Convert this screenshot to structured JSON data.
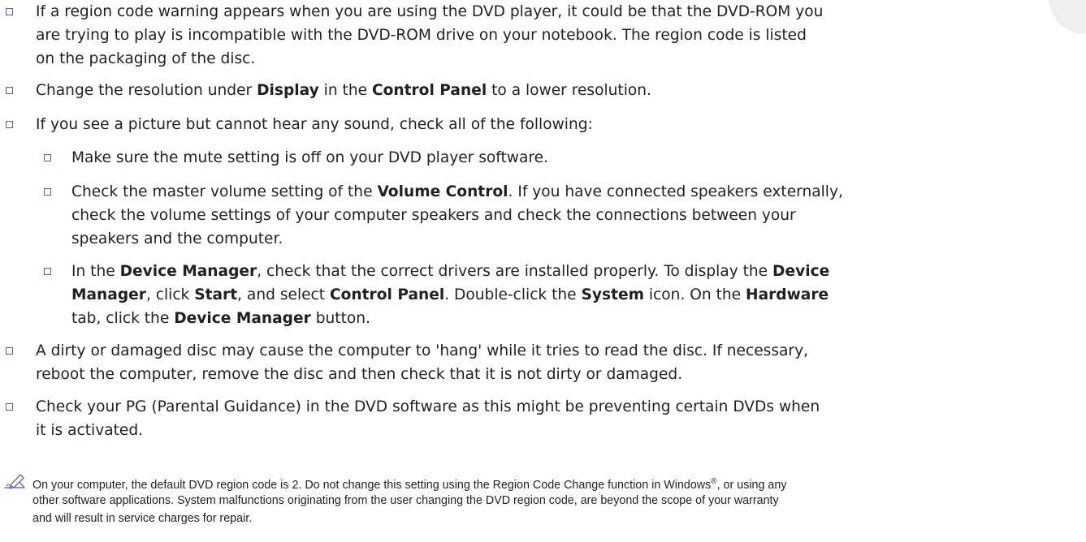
{
  "items": [
    {
      "lines": [
        "If a region code warning appears when you are using the DVD player, it could be that the DVD-ROM you",
        "are trying to play is incompatible with the DVD-ROM drive on your notebook. The region code is listed",
        "on the packaging of the disc."
      ]
    },
    {
      "parts": [
        "Change the resolution under ",
        "Display",
        " in the ",
        "Control Panel",
        " to a lower resolution."
      ]
    },
    {
      "text": "If you see a picture but cannot hear any sound, check all of the following:"
    },
    {
      "text": "Make sure the mute setting is off on your DVD player software."
    },
    {
      "line1_parts": [
        "Check the master volume setting of the ",
        "Volume Control",
        ". If you have connected speakers externally,"
      ],
      "line2": "check the volume settings of your computer speakers and check the connections between your",
      "line3": "speakers and the computer."
    },
    {
      "line1_parts": [
        "In the ",
        "Device Manager",
        ", check that the correct drivers are installed properly. To display the ",
        "Device"
      ],
      "line2_parts": [
        "Manager",
        ", click ",
        "Start",
        ", and select ",
        "Control Panel",
        ". Double-click the ",
        "System",
        " icon. On the ",
        "Hardware"
      ],
      "line3_parts": [
        "tab, click the ",
        "Device Manager",
        " button."
      ]
    },
    {
      "lines": [
        "A dirty or damaged disc may cause the computer to 'hang' while it tries to read the disc. If necessary,",
        "reboot the computer, remove the disc and then check that it is not dirty or damaged."
      ]
    },
    {
      "lines": [
        "Check your PG (Parental Guidance) in the DVD software as this might be preventing certain DVDs when",
        "it is activated."
      ]
    }
  ],
  "note": {
    "line1_a": "On your computer, the default DVD region code is 2. Do not change this setting using the Region Code Change function in Windows",
    "line1_sup": "®",
    "line1_b": ", or using any",
    "line2": "other software applications. System malfunctions originating from the user changing the DVD region code, are beyond the scope of your warranty",
    "line3": "and will result in service charges for repair."
  },
  "colors": {
    "bullet_border": "#5a5aa8",
    "note_icon": "#6b6bb5",
    "text": "#231f20"
  },
  "icons": {
    "bullet": "checkbox-square",
    "note": "pencil-note-icon"
  }
}
